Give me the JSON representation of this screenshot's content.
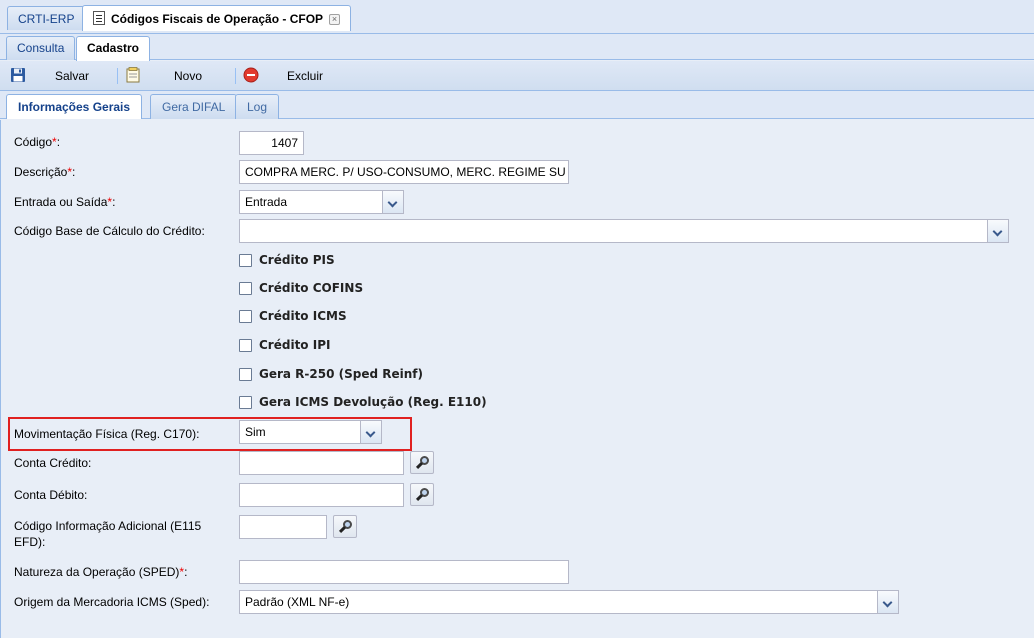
{
  "window_tabs": [
    {
      "label": "CRTI-ERP"
    },
    {
      "label": "Códigos Fiscais de Operação - CFOP"
    }
  ],
  "window_tab_close": "×",
  "sub_tabs": [
    {
      "label": "Consulta"
    },
    {
      "label": "Cadastro"
    }
  ],
  "toolbar": {
    "save_label": "Salvar",
    "new_label": "Novo",
    "delete_label": "Excluir"
  },
  "form_tabs": [
    {
      "label": "Informações Gerais"
    },
    {
      "label": "Gera DIFAL"
    },
    {
      "label": "Log"
    }
  ],
  "form": {
    "codigo": {
      "label": "Código",
      "value": "1407",
      "required": "*",
      "suffix": ":"
    },
    "descricao": {
      "label": "Descrição",
      "value": "COMPRA MERC. P/ USO-CONSUMO, MERC. REGIME SU",
      "required": "*",
      "suffix": ":"
    },
    "entrada_saida": {
      "label": "Entrada ou Saída",
      "value": "Entrada",
      "required": "*",
      "suffix": ":"
    },
    "codigo_base": {
      "label": "Código Base de Cálculo do Crédito:",
      "value": ""
    },
    "checkboxes": [
      {
        "label": "Crédito PIS",
        "checked": false
      },
      {
        "label": "Crédito COFINS",
        "checked": false
      },
      {
        "label": "Crédito ICMS",
        "checked": false
      },
      {
        "label": "Crédito IPI",
        "checked": false
      },
      {
        "label": "Gera R-250 (Sped Reinf)",
        "checked": false
      },
      {
        "label": "Gera ICMS Devolução (Reg. E110)",
        "checked": false
      }
    ],
    "movimentacao": {
      "label": "Movimentação Física (Reg. C170):",
      "value": "Sim"
    },
    "conta_credito": {
      "label": "Conta Crédito:",
      "value": ""
    },
    "conta_debito": {
      "label": "Conta Débito:",
      "value": ""
    },
    "codigo_info": {
      "label_line1": "Código Informação Adicional (E115",
      "label_line2": "EFD):",
      "value": ""
    },
    "natureza": {
      "label": "Natureza da Operação (SPED)",
      "required": "*",
      "suffix": ":",
      "value": ""
    },
    "origem": {
      "label": "Origem da Mercadoria ICMS (Sped):",
      "value": "Padrão (XML NF-e)"
    }
  },
  "colors": {
    "required_marker": "#ee0000",
    "highlight_border": "#e02020",
    "tab_text": "#15428b"
  }
}
